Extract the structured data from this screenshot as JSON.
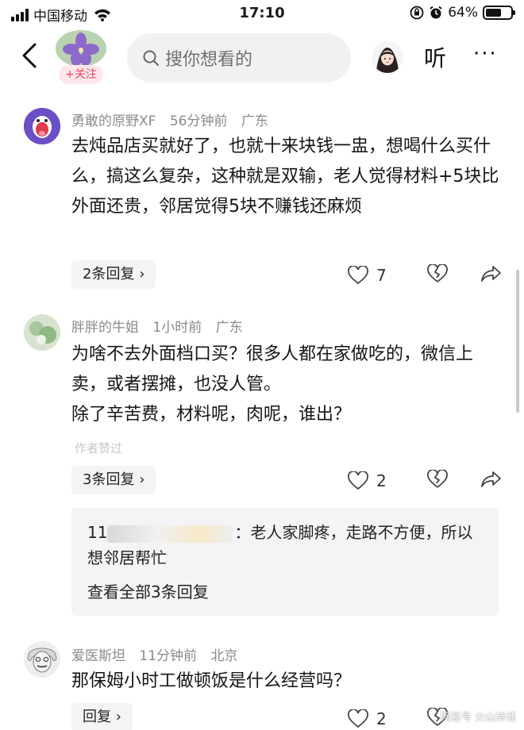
{
  "status_bar": {
    "carrier": "中国移动",
    "time": "17:10",
    "battery": "64%",
    "battery_level": 0.64
  },
  "nav": {
    "follow_label": "+关注",
    "search_placeholder": "搜你想看的",
    "listen_label": "听",
    "more_label": "···"
  },
  "comments": [
    {
      "user": "勇敢的原野XF",
      "time": "56分钟前",
      "location": "广东",
      "text": "去炖品店买就好了，也就十来块钱一盅，想喝什么买什么，搞这么复杂，这种就是双输，老人觉得材料+5块比外面还贵，邻居觉得5块不赚钱还麻烦",
      "replies_label": "2条回复",
      "likes": "7"
    },
    {
      "user": "胖胖的牛姐",
      "time": "1小时前",
      "location": "广东",
      "text_lines": [
        "为啥不去外面档口买？很多人都在家做吃的，微信上卖，或者摆摊，也没人管。",
        "除了辛苦费，材料呢，肉呢，谁出？"
      ],
      "author_liked": "作者赞过",
      "replies_label": "3条回复",
      "likes": "2",
      "reply_preview": {
        "name_prefix": "11",
        "text": "：老人家脚疼，走路不方便，所以想邻居帮忙",
        "view_all": "查看全部3条回复"
      }
    },
    {
      "user": "爱医斯坦",
      "time": "11分钟前",
      "location": "北京",
      "text": "那保姆小时工做顿饭是什么经营吗？",
      "replies_label": "回复",
      "likes": "2"
    }
  ],
  "watermark": "网易号 火山诗话",
  "colors": {
    "follow_text": "#e8425e",
    "follow_bg": "#fde7ea",
    "meta_gray": "#8a8a8a",
    "button_bg": "#f4f4f6"
  }
}
